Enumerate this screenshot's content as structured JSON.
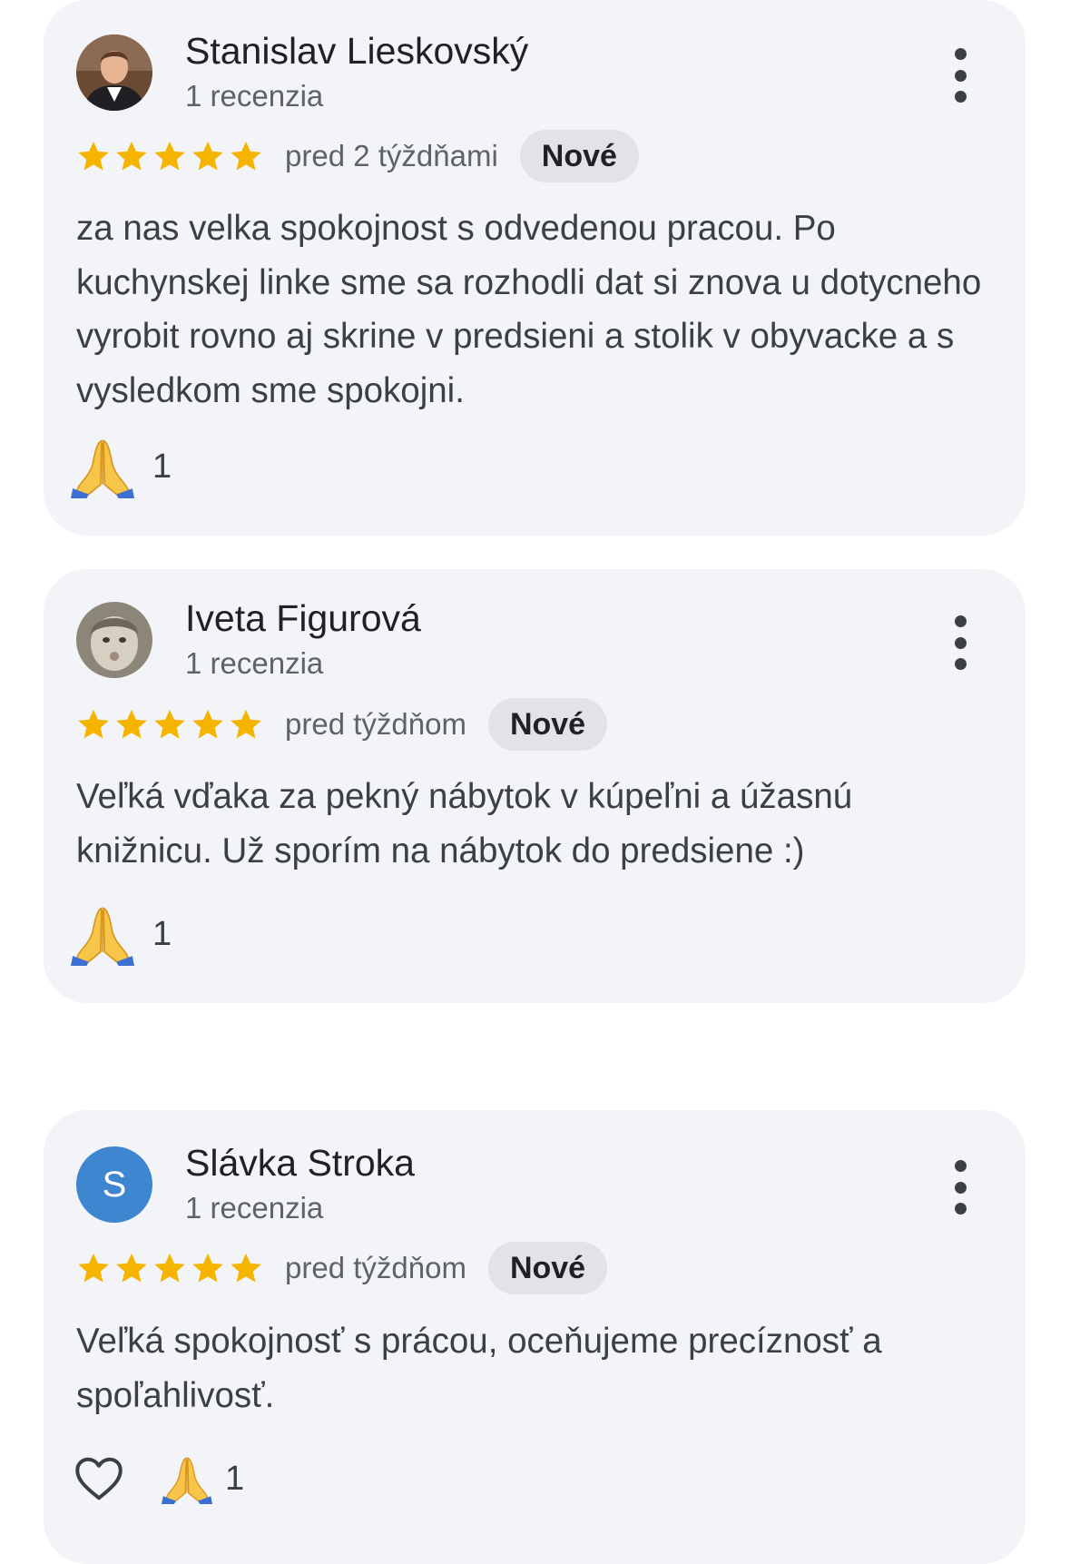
{
  "accent": {
    "star_color": "#f4b400",
    "badge_bg": "#e1e3e6",
    "card_bg": "#f2f4f7",
    "letter_avatar_bg": "#3e86cf"
  },
  "reviews": [
    {
      "name": "Stanislav Lieskovský",
      "count": "1 recenzia",
      "avatar": "photo-man",
      "rating": 5,
      "date": "pred 2 týždňami",
      "badge": "Nové",
      "text": "za nas velka spokojnost s odvedenou pracou. Po kuchynskej linke sme sa rozhodli dat si znova u dotycneho vyrobit rovno aj skrine v predsieni a stolik v obyvacke a s vysledkom sme spokojni.",
      "reaction_icon": "folded-hands-icon",
      "reaction_count": "1"
    },
    {
      "name": "Iveta Figurová",
      "count": "1 recenzia",
      "avatar": "photo-child",
      "rating": 5,
      "date": "pred týždňom",
      "badge": "Nové",
      "text": "Veľká vďaka za pekný nábytok v kúpeľni a úžasnú knižnicu. Už sporím na nábytok do predsiene :)",
      "reaction_icon": "folded-hands-icon",
      "reaction_count": "1"
    },
    {
      "name": "Slávka Stroka",
      "count": "1 recenzia",
      "avatar_letter": "S",
      "rating": 5,
      "date": "pred týždňom",
      "badge": "Nové",
      "text": "Veľká spokojnosť s prácou, oceňujeme precíznosť a spoľahlivosť.",
      "like_icon": "heart-outline-icon",
      "reaction_icon": "folded-hands-icon",
      "reaction_count": "1"
    }
  ]
}
